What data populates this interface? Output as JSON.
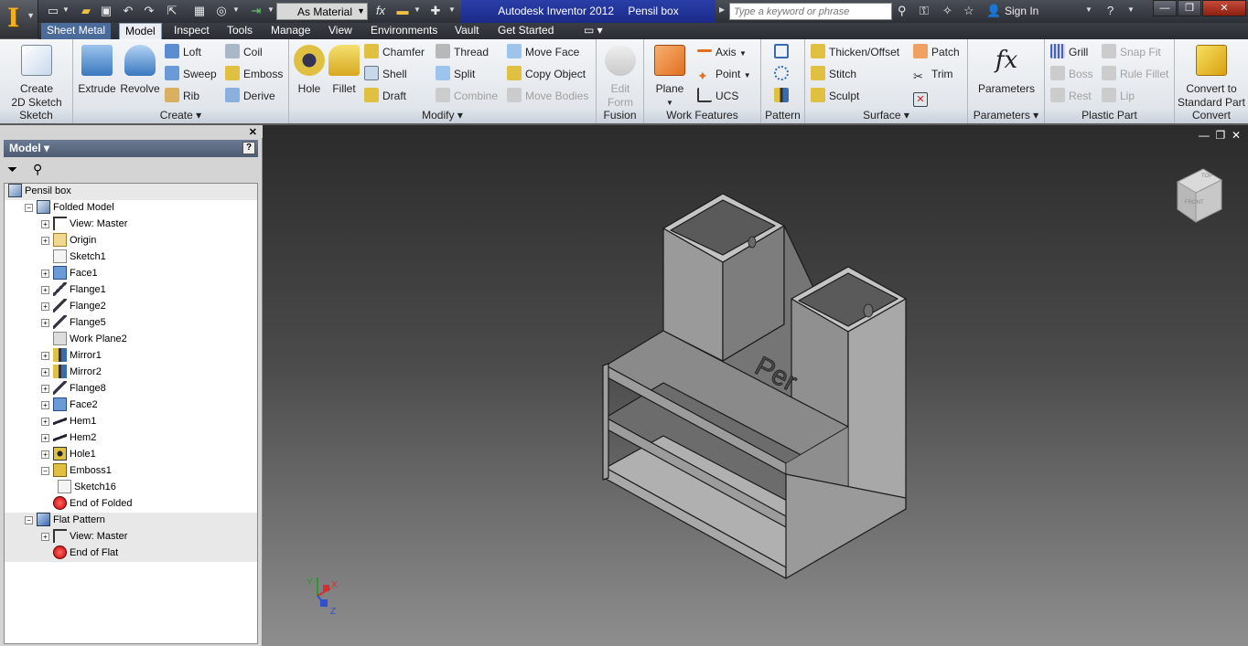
{
  "qat": {
    "material": "As Material",
    "fx": "fx"
  },
  "title": {
    "app": "Autodesk Inventor 2012",
    "doc": "Pensil box",
    "search_placeholder": "Type a keyword or phrase",
    "signin": "Sign In"
  },
  "tabs": [
    "Sheet Metal",
    "Model",
    "Inspect",
    "Tools",
    "Manage",
    "View",
    "Environments",
    "Vault",
    "Get Started"
  ],
  "ribbon": {
    "sketch": {
      "title": "Sketch",
      "create2d": "Create 2D Sketch",
      "create2d_l1": "Create",
      "create2d_l2": "2D Sketch"
    },
    "create": {
      "title": "Create",
      "extrude": "Extrude",
      "revolve": "Revolve",
      "loft": "Loft",
      "sweep": "Sweep",
      "rib": "Rib",
      "coil": "Coil",
      "emboss": "Emboss",
      "derive": "Derive"
    },
    "modify": {
      "title": "Modify",
      "hole": "Hole",
      "fillet": "Fillet",
      "chamfer": "Chamfer",
      "shell": "Shell",
      "draft": "Draft",
      "thread": "Thread",
      "split": "Split",
      "combine": "Combine",
      "moveface": "Move Face",
      "copyobject": "Copy Object",
      "movebodies": "Move Bodies"
    },
    "fusion": {
      "title": "Fusion",
      "edit_l1": "Edit",
      "edit_l2": "Form"
    },
    "workfeatures": {
      "title": "Work Features",
      "plane": "Plane",
      "axis": "Axis",
      "point": "Point",
      "ucs": "UCS"
    },
    "pattern": {
      "title": "Pattern"
    },
    "surface": {
      "title": "Surface",
      "thicken": "Thicken/Offset",
      "stitch": "Stitch",
      "sculpt": "Sculpt",
      "patch": "Patch",
      "trim": "Trim"
    },
    "parameters": {
      "title": "Parameters",
      "label": "Parameters",
      "fx": "fx"
    },
    "plastic": {
      "title": "Plastic Part",
      "grill": "Grill",
      "boss": "Boss",
      "rest": "Rest",
      "snapfit": "Snap Fit",
      "rulefillet": "Rule Fillet",
      "lip": "Lip"
    },
    "convert": {
      "title": "Convert",
      "l1": "Convert to",
      "l2": "Standard Part"
    }
  },
  "browser": {
    "header": "Model",
    "help": "?",
    "tree": [
      {
        "label": "Pensil box",
        "level": 0,
        "icon": "part"
      },
      {
        "label": "Folded Model",
        "level": 1,
        "icon": "folded"
      },
      {
        "label": "View: Master",
        "level": 2,
        "icon": "view"
      },
      {
        "label": "Origin",
        "level": 2,
        "icon": "folder"
      },
      {
        "label": "Sketch1",
        "level": 2,
        "icon": "sketch"
      },
      {
        "label": "Face1",
        "level": 2,
        "icon": "face"
      },
      {
        "label": "Flange1",
        "level": 2,
        "icon": "flange"
      },
      {
        "label": "Flange2",
        "level": 2,
        "icon": "flange"
      },
      {
        "label": "Flange5",
        "level": 2,
        "icon": "flange"
      },
      {
        "label": "Work Plane2",
        "level": 2,
        "icon": "workplane"
      },
      {
        "label": "Mirror1",
        "level": 2,
        "icon": "mirror"
      },
      {
        "label": "Mirror2",
        "level": 2,
        "icon": "mirror"
      },
      {
        "label": "Flange8",
        "level": 2,
        "icon": "flange"
      },
      {
        "label": "Face2",
        "level": 2,
        "icon": "face"
      },
      {
        "label": "Hem1",
        "level": 2,
        "icon": "hem"
      },
      {
        "label": "Hem2",
        "level": 2,
        "icon": "hem"
      },
      {
        "label": "Hole1",
        "level": 2,
        "icon": "hole"
      },
      {
        "label": "Emboss1",
        "level": 2,
        "icon": "emboss"
      },
      {
        "label": "Sketch16",
        "level": 3,
        "icon": "sketch"
      },
      {
        "label": "End of Folded",
        "level": 2,
        "icon": "end"
      },
      {
        "label": "Flat Pattern",
        "level": 1,
        "icon": "flat"
      },
      {
        "label": "View: Master",
        "level": 2,
        "icon": "view"
      },
      {
        "label": "End of Flat",
        "level": 2,
        "icon": "end"
      }
    ]
  },
  "viewport": {
    "viewcube_front": "FRONT",
    "viewcube_top": "TOP",
    "emboss_text": "Per",
    "axis_x": "X",
    "axis_y": "Y",
    "axis_z": "Z"
  }
}
